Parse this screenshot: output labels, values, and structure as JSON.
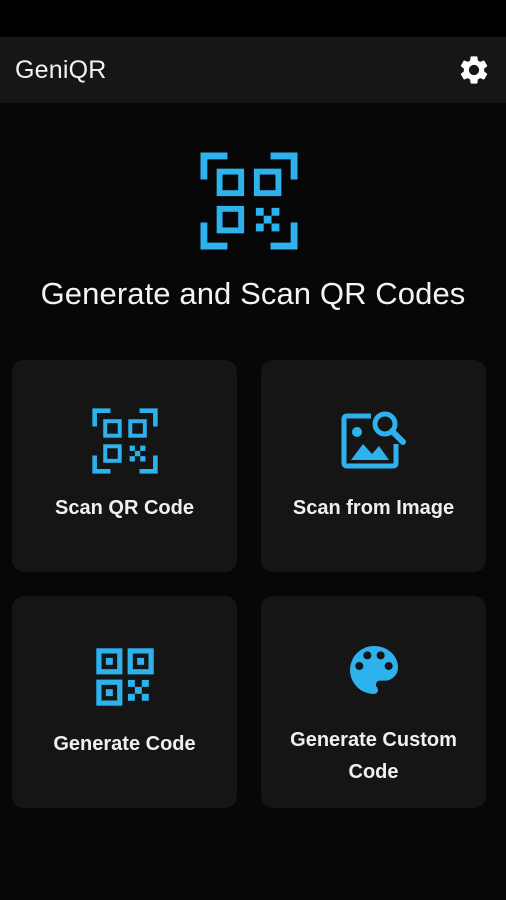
{
  "appbar": {
    "title": "GeniQR",
    "settings_icon": "gear-icon"
  },
  "hero": {
    "icon": "qr-scan-icon",
    "headline": "Generate and Scan QR Codes"
  },
  "cards": [
    {
      "label": "Scan QR Code",
      "icon": "qr-scan-icon"
    },
    {
      "label": "Scan from Image",
      "icon": "image-search-icon"
    },
    {
      "label": "Generate Code",
      "icon": "qr-code-icon"
    },
    {
      "label": "Generate Custom Code",
      "icon": "palette-icon"
    }
  ],
  "colors": {
    "accent": "#2eb2ee",
    "background": "#070707",
    "appbar": "#161616",
    "card": "#151515"
  }
}
